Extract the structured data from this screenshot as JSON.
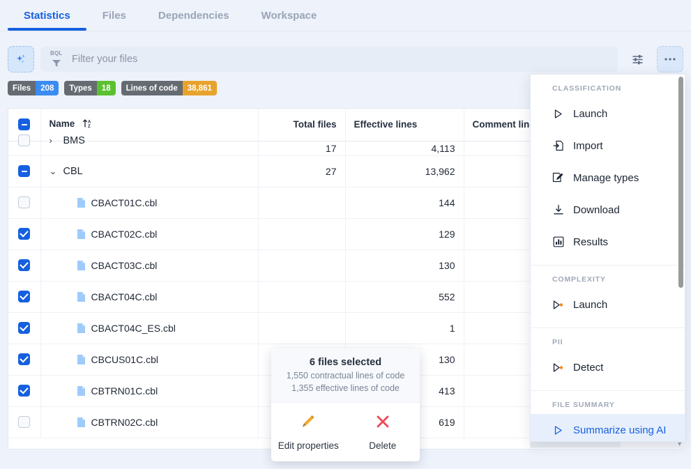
{
  "tabs": [
    {
      "label": "Statistics",
      "active": true
    },
    {
      "label": "Files",
      "active": false
    },
    {
      "label": "Dependencies",
      "active": false
    },
    {
      "label": "Workspace",
      "active": false
    }
  ],
  "toolbar": {
    "ai_icon": "sparkles-icon",
    "bql_label": "BQL",
    "filter_placeholder": "Filter your files",
    "filter_value": "",
    "settings_icon": "sliders-icon",
    "more_icon": "ellipsis-icon"
  },
  "badges": [
    {
      "key": "Files",
      "value": "208",
      "color": "#3b8cf0"
    },
    {
      "key": "Types",
      "value": "18",
      "color": "#5cc12f"
    },
    {
      "key": "Lines of code",
      "value": "38,861",
      "color": "#e8a32c"
    }
  ],
  "table": {
    "columns": [
      "Name",
      "Total files",
      "Effective lines",
      "Comment lines"
    ],
    "sort_icon": "sort-az-ascending-icon",
    "header_checkbox": "indeterminate",
    "rows": [
      {
        "type": "group",
        "checkbox": "off",
        "expanded": false,
        "name": "BMS",
        "total_files": "17",
        "effective_lines": "4,113",
        "comment_lines": "",
        "clipped": true
      },
      {
        "type": "group",
        "checkbox": "indeterminate",
        "expanded": true,
        "name": "CBL",
        "total_files": "27",
        "effective_lines": "13,962",
        "comment_lines": ""
      },
      {
        "type": "file",
        "checkbox": "off",
        "name": "CBACT01C.cbl",
        "total_files": "",
        "effective_lines": "144",
        "comment_lines": ""
      },
      {
        "type": "file",
        "checkbox": "on",
        "name": "CBACT02C.cbl",
        "total_files": "",
        "effective_lines": "129",
        "comment_lines": ""
      },
      {
        "type": "file",
        "checkbox": "on",
        "name": "CBACT03C.cbl",
        "total_files": "",
        "effective_lines": "130",
        "comment_lines": ""
      },
      {
        "type": "file",
        "checkbox": "on",
        "name": "CBACT04C.cbl",
        "total_files": "",
        "effective_lines": "552",
        "comment_lines": ""
      },
      {
        "type": "file",
        "checkbox": "on",
        "name": "CBACT04C_ES.cbl",
        "total_files": "",
        "effective_lines": "1",
        "comment_lines": ""
      },
      {
        "type": "file",
        "checkbox": "on",
        "name": "CBCUS01C.cbl",
        "total_files": "",
        "effective_lines": "130",
        "comment_lines": ""
      },
      {
        "type": "file",
        "checkbox": "on",
        "name": "CBTRN01C.cbl",
        "total_files": "",
        "effective_lines": "413",
        "comment_lines": ""
      },
      {
        "type": "file",
        "checkbox": "off",
        "name": "CBTRN02C.cbl",
        "total_files": "",
        "effective_lines": "619",
        "comment_lines": ""
      }
    ]
  },
  "menu": {
    "sections": [
      {
        "label": "CLASSIFICATION",
        "items": [
          {
            "label": "Launch",
            "icon": "play-triangle-icon",
            "selected": false
          },
          {
            "label": "Import",
            "icon": "import-document-icon",
            "selected": false
          },
          {
            "label": "Manage types",
            "icon": "document-pencil-icon",
            "selected": false
          },
          {
            "label": "Download",
            "icon": "download-arrow-icon",
            "selected": false
          },
          {
            "label": "Results",
            "icon": "bar-chart-icon",
            "selected": false
          }
        ]
      },
      {
        "label": "COMPLEXITY",
        "items": [
          {
            "label": "Launch",
            "icon": "play-triangle-dot-icon",
            "selected": false
          }
        ]
      },
      {
        "label": "PII",
        "items": [
          {
            "label": "Detect",
            "icon": "play-triangle-dot-icon",
            "selected": false
          }
        ]
      },
      {
        "label": "FILE SUMMARY",
        "items": [
          {
            "label": "Summarize using AI",
            "icon": "play-triangle-icon",
            "selected": true
          }
        ]
      }
    ],
    "accent": "#1560e0"
  },
  "selection_popup": {
    "title": "6 files selected",
    "line1": "1,550 contractual lines of code",
    "line2": "1,355 effective lines of code",
    "actions": [
      {
        "label": "Edit properties",
        "icon": "pencil-icon",
        "color": "#f0a830"
      },
      {
        "label": "Delete",
        "icon": "cross-icon",
        "color": "#ef4b5a"
      }
    ]
  }
}
